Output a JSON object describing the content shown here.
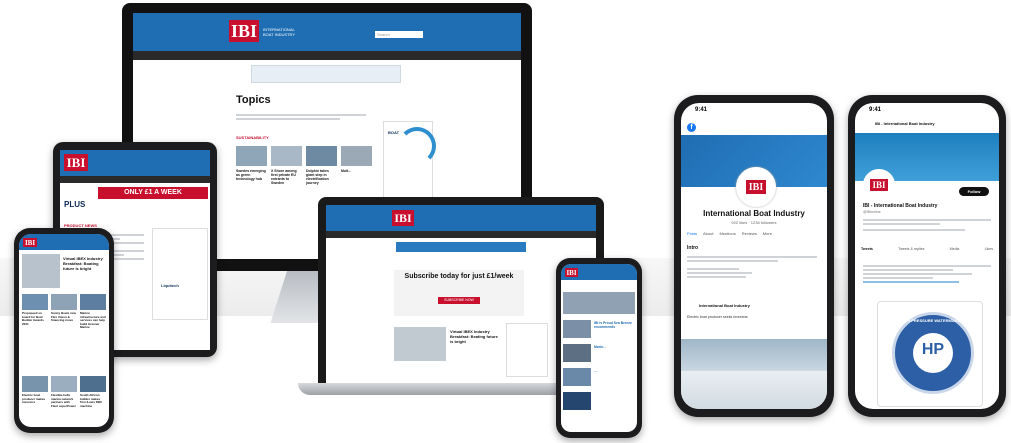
{
  "brand": {
    "logo_text": "IBI",
    "name_line1": "INTERNATIONAL",
    "name_line2": "BOAT INDUSTRY"
  },
  "desktop": {
    "page_title": "Topics",
    "section_label": "SUSTAINABILITY",
    "article_titles": [
      "Swedes emerging as green technology hub",
      "X Shore among first private EU entrants to Sweden",
      "Dolphin takes giant step in electrification journey",
      "Mult..."
    ],
    "ad_text": "BOAT",
    "search_placeholder": "Search"
  },
  "tablet": {
    "promo_text": "ONLY £1 A WEEK",
    "ad_brand": "PLUS",
    "section_label": "PRODUCT NEWS",
    "ad_word": "Liquitech"
  },
  "laptop": {
    "subscribe_title": "Subscribe today for just £1/week",
    "feature_title": "Virtual IBEX Industry Breakfast: Beating future is bright",
    "button_label": "SUBSCRIBE NOW"
  },
  "phone_left": {
    "feature_title": "Virtual IBEX Industry Breakfast: Boating future is bright",
    "cards": [
      "Propspeed on board for Boat Builder Awards 2021",
      "Sunny Boats new Flex Vision & financing move",
      "Marina infrastructure and services can help build Greener Marine",
      "Electric boat producer makes investors",
      "Flexible-hulls marina network partners with Fleet superPower",
      "South African builder makes first 3-axis DBC machine"
    ]
  },
  "phone_mid": {
    "cards": [
      "IBI is Proud Sea Breeze recommends",
      "Marin...",
      "..."
    ]
  },
  "phone_facebook": {
    "time": "9:41",
    "page_name": "International Boat Industry",
    "likes": "922 likes · 1236 followers",
    "tabs": [
      "Posts",
      "About",
      "Mentions",
      "Reviews",
      "More"
    ],
    "intro_label": "Intro",
    "post_author": "International Boat Industry",
    "post_text": "Electric boat producer seeks investors"
  },
  "phone_twitter": {
    "time": "9:41",
    "header_name": "IBI - International Boat Industry",
    "profile_name": "IBI - International Boat Industry",
    "handle": "@IBIonline",
    "follow_label": "Follow",
    "tabs": [
      "Tweets",
      "Tweets & replies",
      "Media",
      "Likes"
    ],
    "badge_text": "HIGH PRESSURE WATERMAKERS",
    "badge_letters": "HP"
  },
  "colors": {
    "brand_red": "#c8102e",
    "brand_blue": "#1f6db3",
    "device_black": "#1c1c1e",
    "silver": "#c9ccd1"
  }
}
